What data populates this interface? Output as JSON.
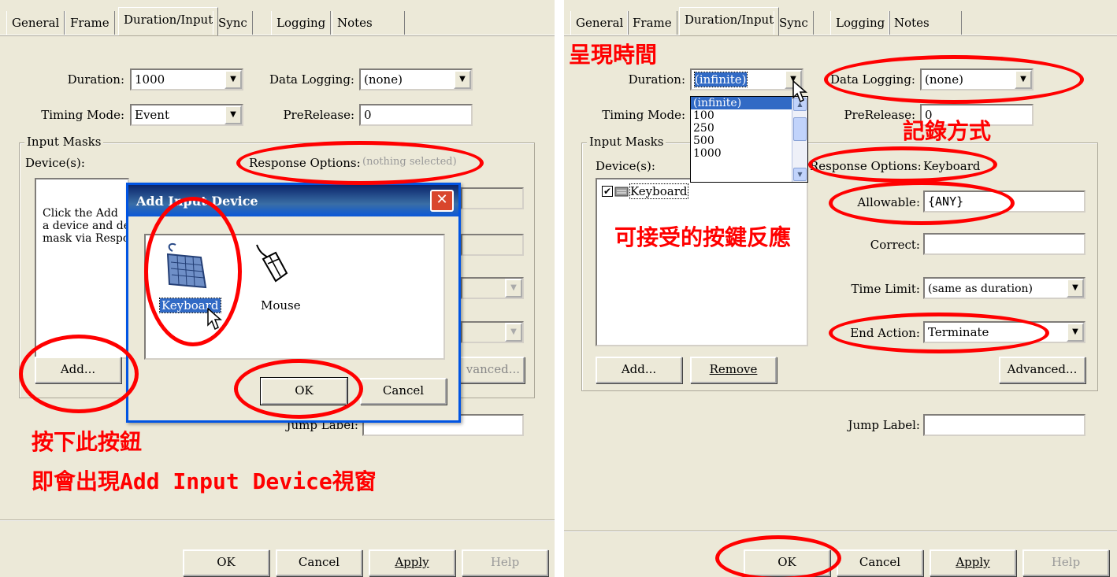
{
  "tabs": [
    "General",
    "Frame",
    "Duration/Input",
    "Sync",
    "Logging",
    "Notes"
  ],
  "left": {
    "duration_label": "Duration:",
    "duration_value": "1000",
    "data_logging_label": "Data Logging:",
    "data_logging_value": "(none)",
    "timing_mode_label": "Timing Mode:",
    "timing_mode_value": "Event",
    "prerelease_label": "PreRelease:",
    "prerelease_value": "0",
    "input_masks_label": "Input Masks",
    "devices_label": "Device(s):",
    "response_options_label": "Response Options:",
    "response_options_value": "(nothing selected)",
    "help_text_lines": [
      "Click the Add",
      "a device and de",
      "mask via Respo"
    ],
    "add_button": "Add...",
    "advanced_button": "vanced...",
    "jump_label": "Jump Label:",
    "annotation_line1": "按下此按鈕",
    "annotation_line2": "即會出現Add Input Device視窗",
    "footer_buttons": {
      "ok": "OK",
      "cancel": "Cancel",
      "apply": "Apply",
      "help": "Help"
    }
  },
  "dialog": {
    "title": "Add Input Device",
    "close_icon": "close-x",
    "devices": [
      {
        "label": "Keyboard",
        "icon": "keyboard-icon",
        "selected": true
      },
      {
        "label": "Mouse",
        "icon": "mouse-icon",
        "selected": false
      }
    ],
    "ok_button": "OK",
    "cancel_button": "Cancel"
  },
  "right": {
    "annotation_duration": "呈現時間",
    "duration_label": "Duration:",
    "duration_value": "(infinite)",
    "duration_options": [
      "(infinite)",
      "100",
      "250",
      "500",
      "1000"
    ],
    "data_logging_label": "Data Logging:",
    "data_logging_value": "(none)",
    "timing_mode_label": "Timing Mode:",
    "prerelease_label": "PreRelease:",
    "prerelease_value": "0",
    "annotation_logging": "記錄方式",
    "input_masks_label": "Input Masks",
    "devices_label": "Device(s):",
    "device_item": "Keyboard",
    "device_checked": true,
    "response_options_label": "Response Options:",
    "response_options_value": "Keyboard",
    "allowable_label": "Allowable:",
    "allowable_value": "{ANY}",
    "annotation_allowable": "可接受的按鍵反應",
    "correct_label": "Correct:",
    "correct_value": "",
    "time_limit_label": "Time Limit:",
    "time_limit_value": "(same as duration)",
    "end_action_label": "End Action:",
    "end_action_value": "Terminate",
    "add_button": "Add...",
    "remove_button": "Remove",
    "advanced_button": "Advanced...",
    "jump_label": "Jump Label:",
    "footer_buttons": {
      "ok": "OK",
      "cancel": "Cancel",
      "apply": "Apply",
      "help": "Help"
    }
  },
  "colors": {
    "annotation": "#ff0000",
    "selection": "#316ac5",
    "dialog_title": "#0a58d8"
  }
}
